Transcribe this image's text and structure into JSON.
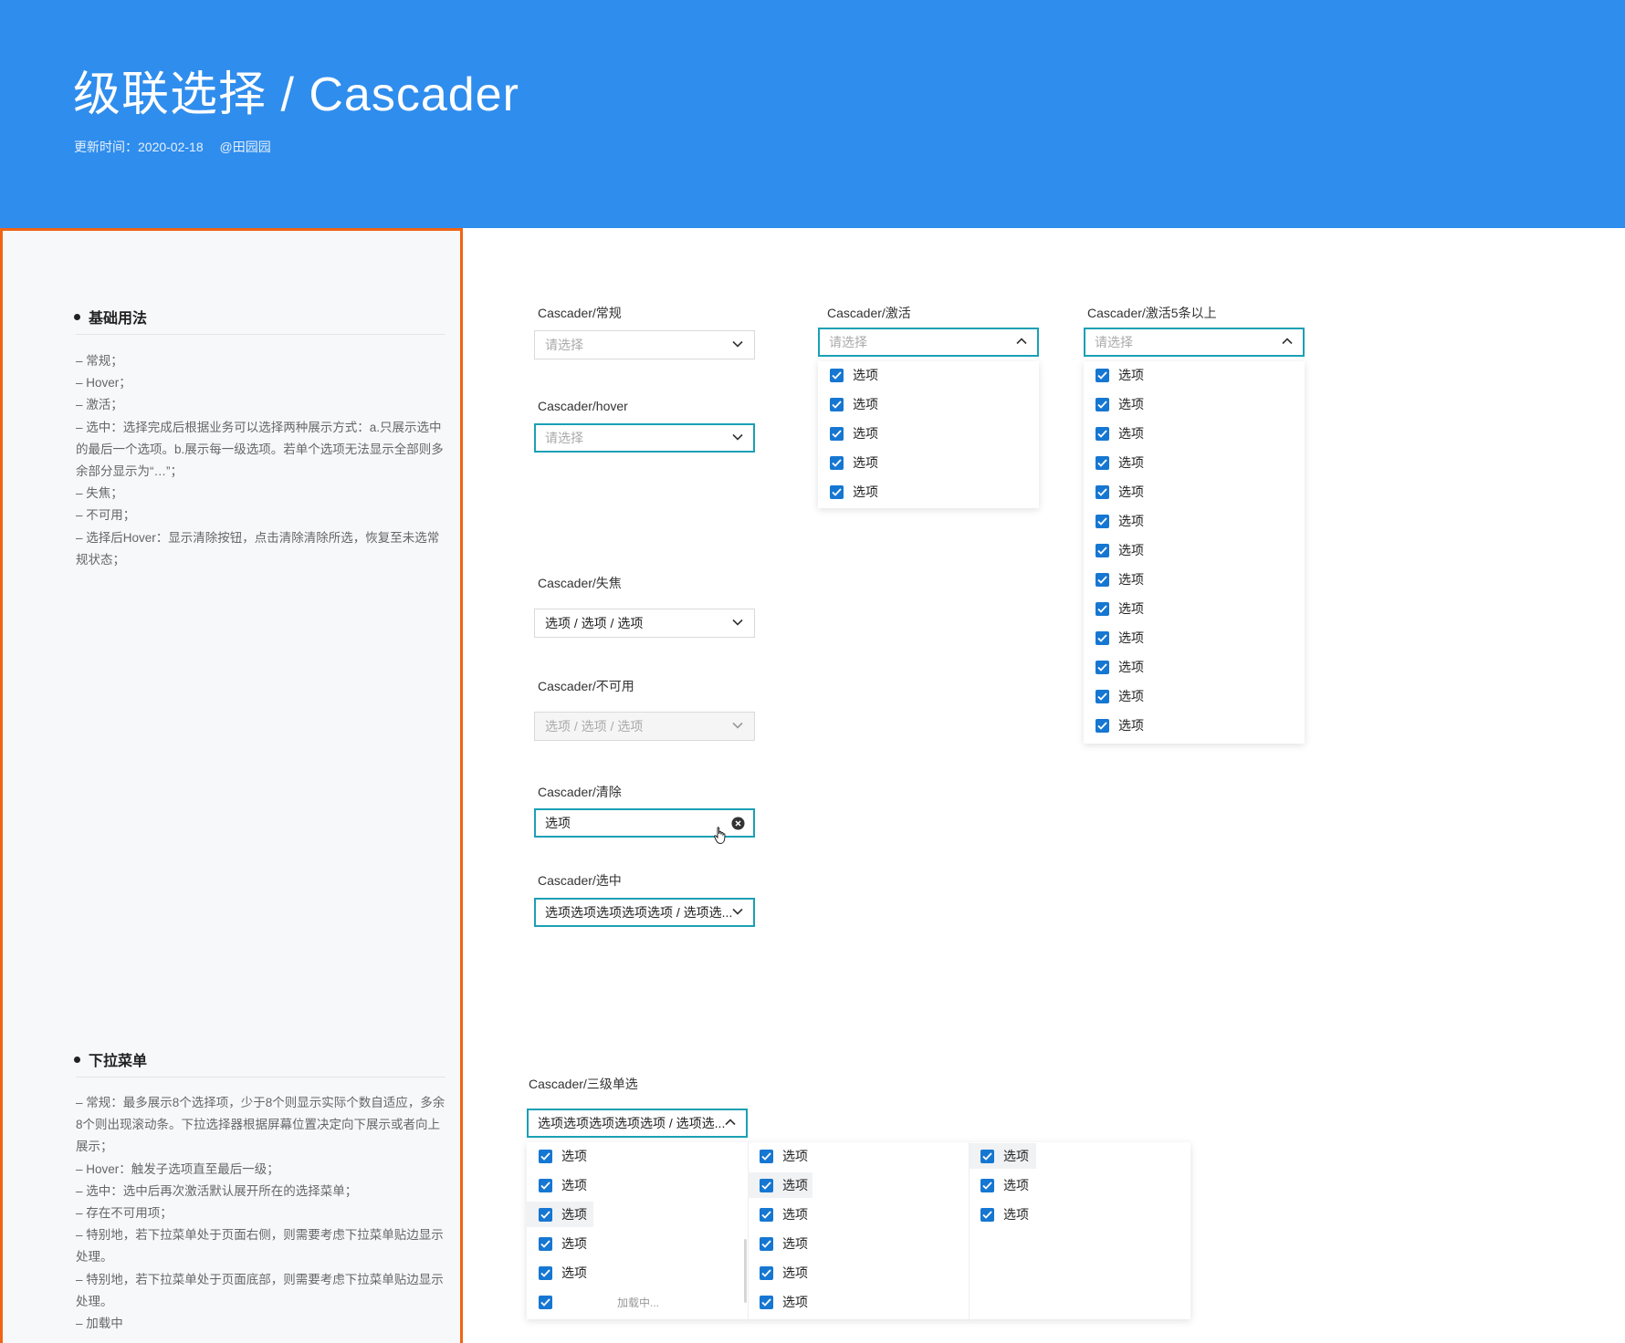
{
  "header": {
    "title": "级联选择 / Cascader",
    "updated": "更新时间：2020-02-18",
    "author": "@田园园",
    "bg_color": "#2f8ded"
  },
  "sidebar": {
    "border_color": "#f06414",
    "basic": {
      "title": "基础用法",
      "lines": [
        "– 常规；",
        "– Hover；",
        "– 激活；",
        "– 选中：选择完成后根据业务可以选择两种展示方式：a.只展示选中的最后一个选项。b.展示每一级选项。若单个选项无法显示全部则多余部分显示为“…”；",
        "– 失焦；",
        "– 不可用；",
        "– 选择后Hover：显示清除按钮，点击清除清除所选，恢复至未选常规状态；"
      ]
    },
    "dropdown": {
      "title": "下拉菜单",
      "lines": [
        "– 常规：最多展示8个选择项，少于8个则显示实际个数自适应，多余8个则出现滚动条。下拉选择器根据屏幕位置决定向下展示或者向上展示；",
        "– Hover：触发子选项直至最后一级；",
        "– 选中：选中后再次激活默认展开所在的选择菜单；",
        "– 存在不可用项；",
        "– 特别地，若下拉菜单处于页面右侧，则需要考虑下拉菜单贴边显示处理。",
        "– 特别地，若下拉菜单处于页面底部，则需要考虑下拉菜单贴边显示处理。",
        "– 加载中"
      ]
    }
  },
  "demos": {
    "normal": {
      "label": "Cascader/常规",
      "placeholder": "请选择"
    },
    "hover": {
      "label": "Cascader/hover",
      "placeholder": "请选择"
    },
    "active": {
      "label": "Cascader/激活",
      "placeholder": "请选择",
      "options": [
        "选项",
        "选项",
        "选项",
        "选项",
        "选项"
      ]
    },
    "active_many": {
      "label": "Cascader/激活5条以上",
      "placeholder": "请选择",
      "options": [
        "选项",
        "选项",
        "选项",
        "选项",
        "选项",
        "选项",
        "选项",
        "选项",
        "选项",
        "选项",
        "选项",
        "选项",
        "选项"
      ]
    },
    "blur": {
      "label": "Cascader/失焦",
      "value": "选项 / 选项 / 选项"
    },
    "disabled": {
      "label": "Cascader/不可用",
      "value": "选项 / 选项 / 选项"
    },
    "clear": {
      "label": "Cascader/清除",
      "value": "选项"
    },
    "selected": {
      "label": "Cascader/选中",
      "value": "选项选项选项选项选项 / 选项选..."
    },
    "three_level": {
      "label": "Cascader/三级单选",
      "value": "选项选项选项选项选项 / 选项选...",
      "col1": [
        "选项",
        "选项",
        "选项",
        "选项",
        "选项"
      ],
      "loading_text": "加载中...",
      "col2": [
        "选项",
        "选项",
        "选项",
        "选项",
        "选项",
        "选项"
      ],
      "col3": [
        "选项",
        "选项",
        "选项"
      ]
    }
  },
  "colors": {
    "accent": "#1aa0b5",
    "checkbox": "#1677d2"
  }
}
